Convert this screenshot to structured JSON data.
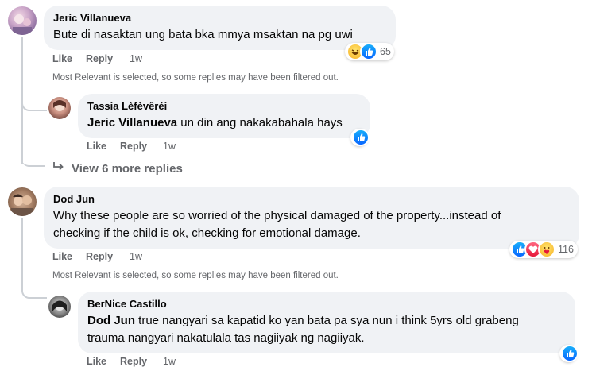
{
  "comments": [
    {
      "author": "Jeric Villanueva",
      "text": "Bute di nasaktan ung bata bka mmya msaktan na pg uwi",
      "like": "Like",
      "reply": "Reply",
      "time": "1w",
      "reaction_count": "65",
      "reaction_icons": [
        "haha-icon",
        "like-icon"
      ],
      "filter_note": "Most Relevant is selected, so some replies may have been filtered out.",
      "reply_item": {
        "author": "Tassia Lèfèvêréi",
        "mention": "Jeric Villanueva",
        "text": " un din ang nakakabahala hays",
        "like": "Like",
        "reply": "Reply",
        "time": "1w",
        "reaction_icons": [
          "like-icon"
        ]
      },
      "more_replies": "View 6 more replies"
    },
    {
      "author": "Dod Jun",
      "text_line1": "Why these people are so worried of the physical damaged of the property...instead of",
      "text_line2": "checking if the child is ok, checking for emotional damage.",
      "like": "Like",
      "reply": "Reply",
      "time": "1w",
      "reaction_count": "116",
      "reaction_icons": [
        "like-icon",
        "love-icon",
        "care-icon"
      ],
      "filter_note": "Most Relevant is selected, so some replies may have been filtered out.",
      "reply_item": {
        "author": "BerNice Castillo",
        "mention": "Dod Jun",
        "text_line1": " true nangyari sa kapatid ko yan bata pa sya nun i think 5yrs old grabeng",
        "text_line2": "trauma nangyari nakatulala tas nagiiyak ng nagiiyak.",
        "like": "Like",
        "reply": "Reply",
        "time": "1w",
        "reaction_icons": [
          "like-icon"
        ]
      }
    }
  ],
  "colors": {
    "bubble": "#f0f2f5",
    "secondary_text": "#65676b",
    "like_blue": "#0866ff"
  }
}
